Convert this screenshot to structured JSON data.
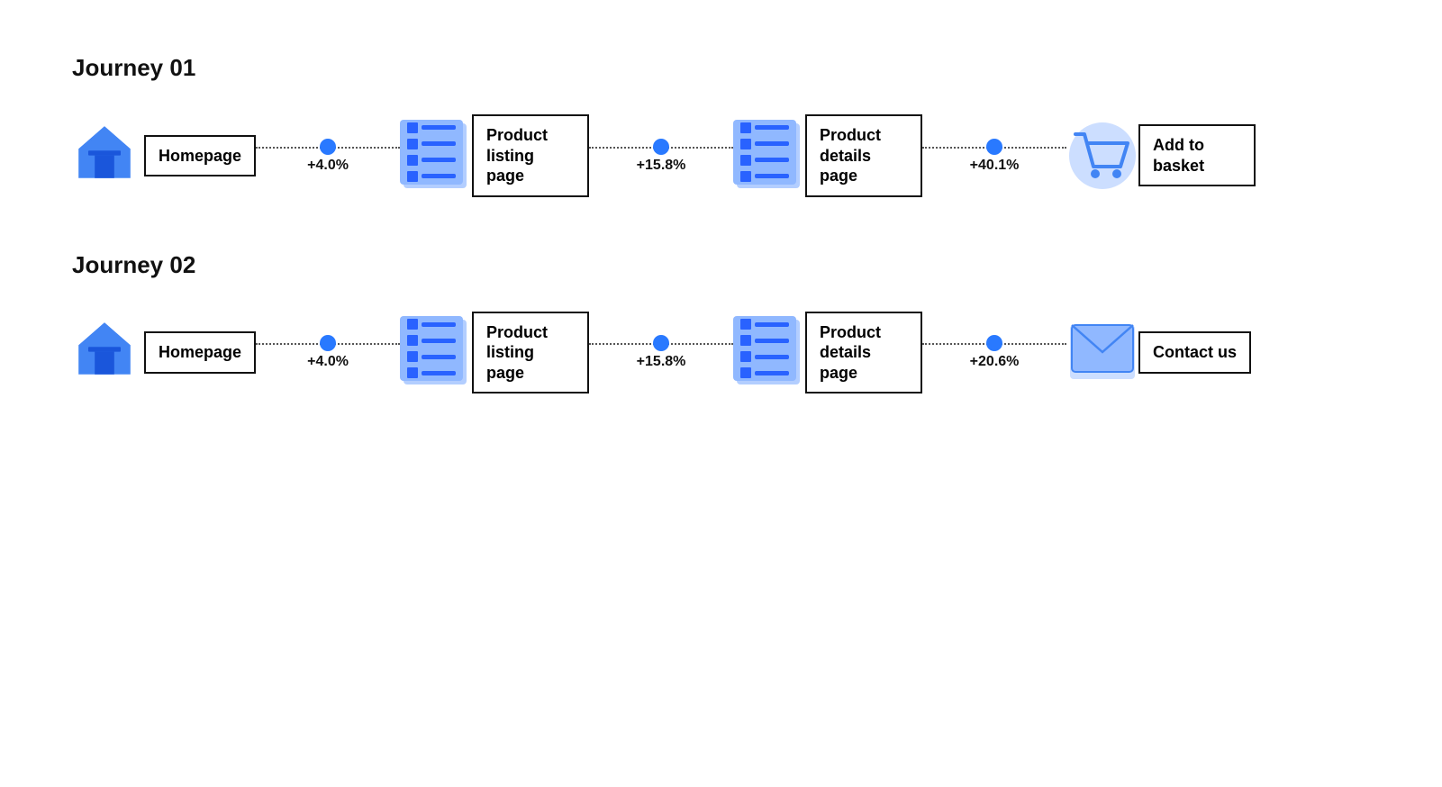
{
  "journeys": [
    {
      "id": "journey-01",
      "title": "Journey 01",
      "nodes": [
        {
          "id": "home1",
          "icon": "home",
          "label": "Homepage",
          "wrap": false
        },
        {
          "id": "plp1",
          "icon": "list",
          "label": "Product listing page",
          "wrap": true
        },
        {
          "id": "pdp1",
          "icon": "list",
          "label": "Product details page",
          "wrap": true
        },
        {
          "id": "basket1",
          "icon": "cart",
          "label": "Add to basket",
          "wrap": true
        }
      ],
      "connectors": [
        {
          "pct": "+4.0%"
        },
        {
          "pct": "+15.8%"
        },
        {
          "pct": "+40.1%"
        }
      ]
    },
    {
      "id": "journey-02",
      "title": "Journey 02",
      "nodes": [
        {
          "id": "home2",
          "icon": "home",
          "label": "Homepage",
          "wrap": false
        },
        {
          "id": "plp2",
          "icon": "list",
          "label": "Product listing page",
          "wrap": true
        },
        {
          "id": "pdp2",
          "icon": "list",
          "label": "Product details page",
          "wrap": true
        },
        {
          "id": "contact2",
          "icon": "envelope",
          "label": "Contact us",
          "wrap": true
        }
      ],
      "connectors": [
        {
          "pct": "+4.0%"
        },
        {
          "pct": "+15.8%"
        },
        {
          "pct": "+20.6%"
        }
      ]
    }
  ]
}
